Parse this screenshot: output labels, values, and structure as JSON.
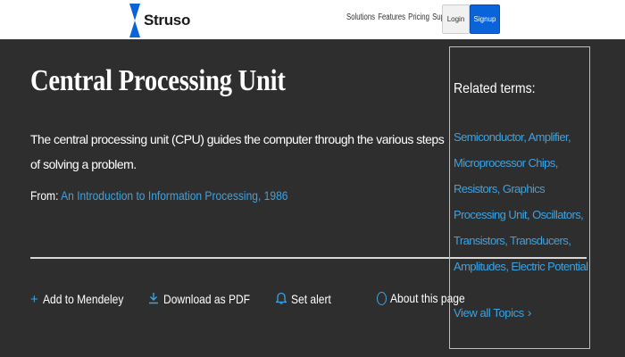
{
  "header": {
    "logo_text": "Struso",
    "brand_color": "#0a63d8",
    "nav": [
      "Solutions",
      "Features",
      "Pricing",
      "Support"
    ],
    "login_label": "Login",
    "signup_label": "Signup"
  },
  "article": {
    "title": "Central Processing Unit",
    "definition": "The central processing unit (CPU) guides the computer through the various steps of solving a problem.",
    "from_label": "From:",
    "source_link": "An Introduction to Information Processing, 1986"
  },
  "actions": [
    {
      "label": "Add to Mendeley",
      "icon": "plus-icon"
    },
    {
      "label": "Download as PDF",
      "icon": "download-icon"
    },
    {
      "label": "Set alert",
      "icon": "bell-icon"
    }
  ],
  "about": {
    "label": "About this page",
    "icon": "info-icon"
  },
  "related": {
    "heading": "Related terms:",
    "terms": [
      "Semiconductor",
      "Amplifier",
      "Microprocessor Chips",
      "Resistors",
      "Graphics Processing Unit",
      "Oscillators",
      "Transistors",
      "Transducers",
      "Amplitudes",
      "Electric Potential"
    ],
    "view_all": "View all Topics"
  },
  "colors": {
    "background": "#2e2e2e",
    "link": "#3aa3e3",
    "text": "#ffffff"
  }
}
